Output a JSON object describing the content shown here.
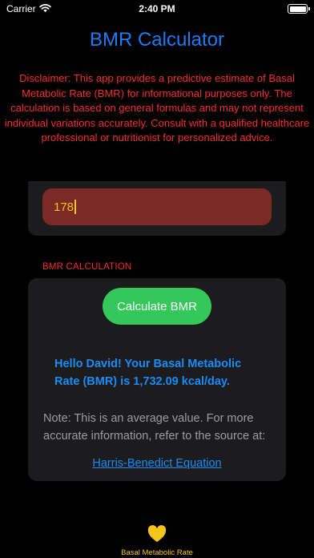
{
  "status_bar": {
    "carrier": "Carrier",
    "time": "2:40 PM"
  },
  "header": {
    "title": "BMR Calculator"
  },
  "disclaimer": "Disclaimer: This app provides a predictive estimate of Basal Metabolic Rate (BMR) for informational purposes only. The calculation is based on general formulas and may not represent individual variations accurately. Consult with a qualified healthcare professional or nutritionist for personalized advice.",
  "input": {
    "value": "178"
  },
  "bmr_section": {
    "header": "BMR CALCULATION",
    "button_label": "Calculate BMR",
    "result": "Hello David! Your Basal Metabolic Rate (BMR) is 1,732.09 kcal/day.",
    "note": "Note: This is an average value. For more accurate information, refer to the source at:",
    "source_link": "Harris-Benedict Equation"
  },
  "tab_bar": {
    "label": "Basal Metabolic Rate",
    "icon": "heart-icon"
  },
  "colors": {
    "title_blue": "#1e7cf2",
    "disclaimer_red": "#f0302a",
    "input_bg": "#7b2a24",
    "input_text": "#f5c227",
    "button_green": "#34c759",
    "result_blue": "#1a8cf4",
    "note_gray": "#9c9ca2",
    "tab_yellow": "#f5c518"
  }
}
